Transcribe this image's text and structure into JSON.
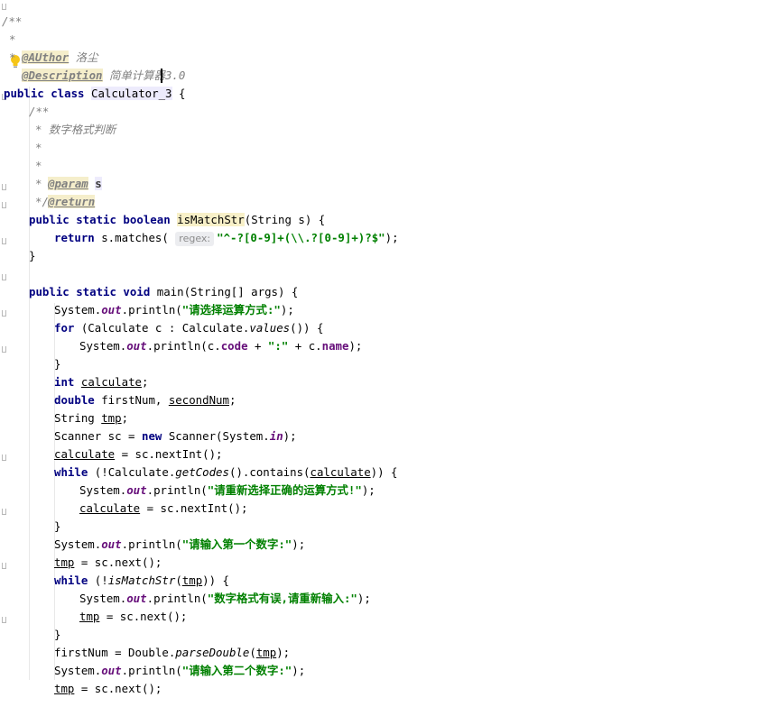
{
  "editor": {
    "lines": [
      {
        "id": "l0",
        "text": "/**"
      },
      {
        "id": "l1",
        "tag": "@AUthor",
        "rest": " 洛尘"
      },
      {
        "id": "l2",
        "tag": "@Description",
        "rest": " 简单计算器3.0"
      },
      {
        "id": "l4a",
        "text": "public class "
      },
      {
        "id": "l4b",
        "text": "Calculator_3"
      },
      {
        "id": "l4c",
        "text": " {"
      },
      {
        "id": "l5",
        "text": "/**"
      },
      {
        "id": "l6",
        "text": "* 数字格式判断"
      },
      {
        "id": "l7",
        "text": "*"
      },
      {
        "id": "l8",
        "tag": "@param",
        "rest": "s"
      },
      {
        "id": "l9",
        "tag": "@return"
      },
      {
        "id": "l10",
        "text": "*/"
      },
      {
        "id": "l11",
        "text": "public static boolean "
      },
      {
        "id": "l11m",
        "text": "isMatchStr"
      },
      {
        "id": "l11e",
        "text": "(String s) {"
      },
      {
        "id": "l12",
        "text": "return s.matches( "
      },
      {
        "id": "l12hint",
        "text": "regex:"
      },
      {
        "id": "l12s",
        "text": "\"^-?[0-9]+(\\\\.?[0-9]+)?$\""
      },
      {
        "id": "l12e",
        "text": ");"
      },
      {
        "id": "l13",
        "text": "}"
      }
    ],
    "main": {
      "sig": "public static void main(String[] args) {",
      "p1": "\"请选择运算方式:\"",
      "for_kw": "for",
      "for_rest": " (Calculate c : Calculate.",
      "values": "values",
      "for_end": "()) {",
      "p2_a": "(c.",
      "code": "code",
      "p2_b": " + ",
      "colon": "\":\"",
      "p2_c": " + c.",
      "name": "name",
      "p2_d": ");",
      "close": "}",
      "int_kw": "int",
      "calculate": "calculate",
      "double_kw": "double",
      "firstNum": " firstNum, ",
      "secondNum": "secondNum",
      "string_kw": "String ",
      "tmp": "tmp",
      "scanner_a": "Scanner sc = ",
      "new_kw": "new",
      "scanner_b": " Scanner(System.",
      "in": "in",
      "scanner_c": ");",
      "assign_next_int": " = sc.nextInt();",
      "while_kw": "while",
      "while1_a": " (!Calculate.",
      "getCodes": "getCodes",
      "while1_b": "().contains(",
      "while1_c": ")) {",
      "p3": "\"请重新选择正确的运算方式!\"",
      "p4": "\"请输入第一个数字:\"",
      "assign_next": " = sc.next();",
      "while2_a": " (!",
      "isMatchStr": "isMatchStr",
      "while2_b": "(",
      "while2_c": ")) {",
      "p5": "\"数字格式有误,请重新输入:\"",
      "first_parse_a": "firstNum = Double.",
      "parseDouble": "parseDouble",
      "first_parse_b": "(",
      "first_parse_c": ");",
      "p6": "\"请输入第二个数字:\"",
      "sys_a": "System.",
      "out": "out",
      "println": ".println(",
      "println_end": ");",
      "semi": ";"
    }
  }
}
